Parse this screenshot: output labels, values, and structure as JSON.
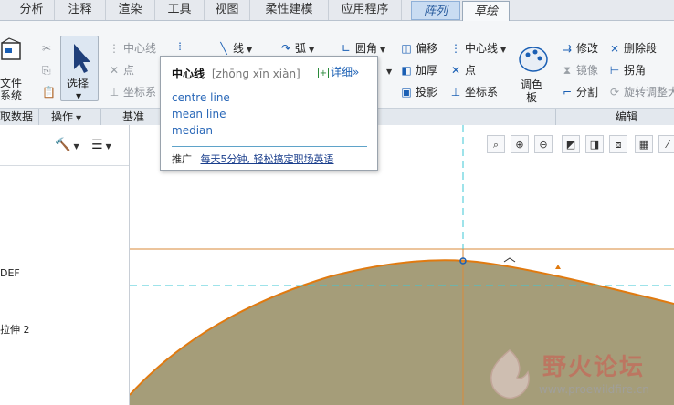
{
  "tabs": [
    {
      "label": "分析"
    },
    {
      "label": "注释"
    },
    {
      "label": "渲染"
    },
    {
      "label": "工具"
    },
    {
      "label": "视图"
    },
    {
      "label": "柔性建模"
    },
    {
      "label": "应用程序"
    },
    {
      "label": "阵列"
    },
    {
      "label": "草绘"
    }
  ],
  "ribbon": {
    "file_label1": "文件",
    "file_label2": "系统",
    "select_label": "选择",
    "centerline": "中心线",
    "point": "点",
    "coord_sys": "坐标系",
    "line": "线",
    "arc": "弧",
    "fillet": "圆角",
    "offset": "偏移",
    "thicken": "加厚",
    "project": "投影",
    "centerline2": "中心线",
    "point2": "点",
    "coord_sys2": "坐标系",
    "palette1": "调色",
    "palette2": "板",
    "modify": "修改",
    "delete_seg": "删除段",
    "mirror": "镜像",
    "corner": "拐角",
    "divide": "分割",
    "rotate_resize": "旋转调整大小"
  },
  "groups": {
    "get_data": "取数据",
    "operations": "操作",
    "datum": "基准",
    "edit": "编辑"
  },
  "tree": {
    "item_def": "DEF",
    "item_extrude": "拉伸 2"
  },
  "tooltip": {
    "word": "中心线",
    "pinyin": "[zhōng  xīn  xiàn]",
    "detail": "详细»",
    "definitions": [
      "centre line",
      "mean line",
      "median"
    ],
    "promo_label": "推广",
    "promo_link": "每天5分钟, 轻松搞定职场英语"
  },
  "watermark": {
    "title": "野火论坛",
    "url": "www.proewildfire.cn"
  },
  "colors": {
    "accent": "#1a5fb4",
    "sketch_fill": "#a59d79",
    "axis_cyan": "#3cc7d6",
    "axis_orange": "#d98a3a"
  }
}
